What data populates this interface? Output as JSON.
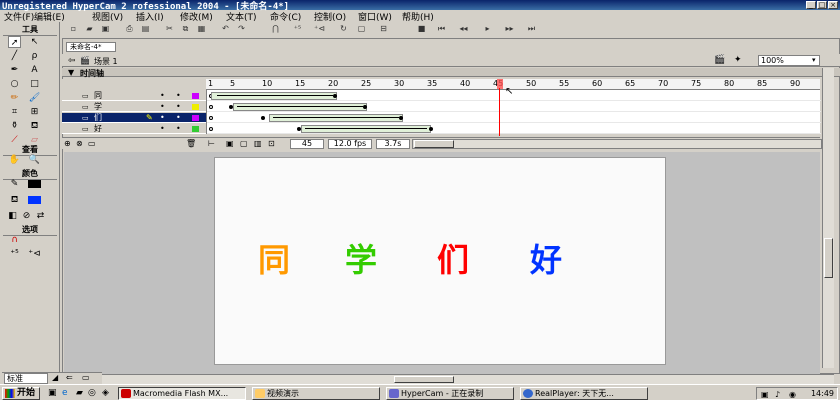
{
  "window": {
    "title": "Unregistered HyperCam 2 rofessional 2004 - [未命名-4*]"
  },
  "menu": [
    "文件(F)",
    "编辑(E)",
    "视图(V)",
    "插入(I)",
    "修改(M)",
    "文本(T)",
    "命令(C)",
    "控制(O)",
    "窗口(W)",
    "帮助(H)"
  ],
  "tools_panel": {
    "title": "工具",
    "view_label": "查看",
    "colors_label": "颜色",
    "options_label": "选项"
  },
  "document": {
    "tab": "未命名-4*",
    "scene": "场景 1",
    "zoom": "100%"
  },
  "timeline": {
    "label": "时间轴",
    "ruler": [
      "1",
      "5",
      "10",
      "15",
      "20",
      "25",
      "30",
      "35",
      "40",
      "45",
      "50",
      "55",
      "60",
      "65",
      "70",
      "75",
      "80",
      "85",
      "90"
    ],
    "layers": [
      {
        "name": "同",
        "selected": false
      },
      {
        "name": "学",
        "selected": false
      },
      {
        "name": "们",
        "selected": true
      },
      {
        "name": "好",
        "selected": false
      }
    ],
    "current_frame": "45",
    "fps": "12.0 fps",
    "time": "3.7s"
  },
  "stage": {
    "chars": [
      {
        "text": "同",
        "color": "#ff9900"
      },
      {
        "text": "学",
        "color": "#33cc00"
      },
      {
        "text": "们",
        "color": "#ff0000"
      },
      {
        "text": "好",
        "color": "#0033ff"
      }
    ]
  },
  "bottom_palette": {
    "tab": "标准"
  },
  "taskbar": {
    "start": "开始",
    "tasks": [
      "Macromedia Flash MX...",
      "视频演示",
      "HyperCam - 正在录制",
      "RealPlayer: 天下无..."
    ],
    "clock": "14:49"
  }
}
